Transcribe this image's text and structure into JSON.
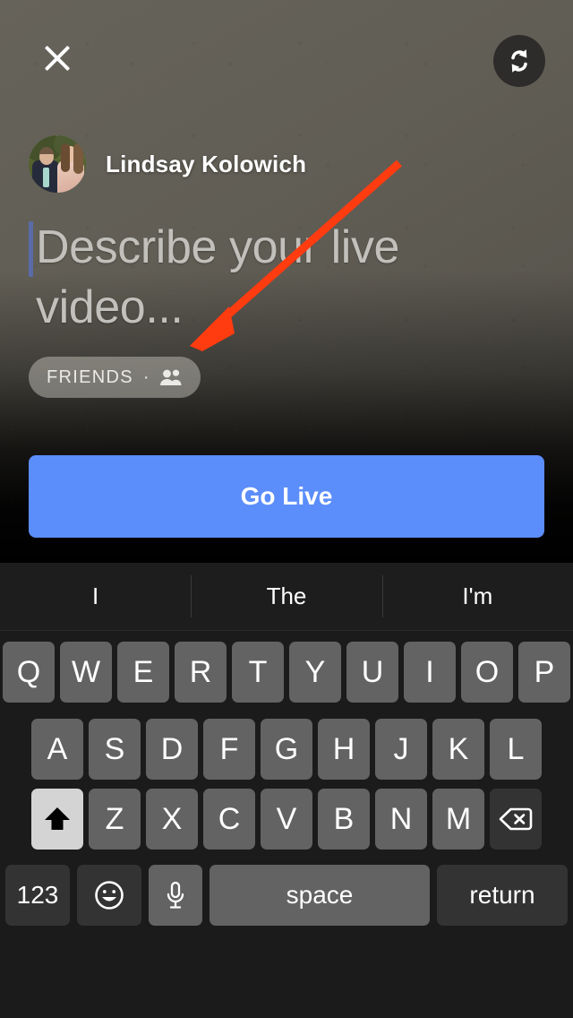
{
  "screen": {
    "app": "facebook-live-composer",
    "background_color": "#605D54",
    "accent_color": "#5B8DFB",
    "annotation_color": "#FF3B10"
  },
  "camera": {
    "close_icon": "close-icon",
    "flip_camera_icon": "camera-flip-icon"
  },
  "composer": {
    "author_name": "Lindsay Kolowich",
    "avatar_icon": "user-avatar-photo",
    "description_placeholder": "Describe your live video...",
    "privacy": {
      "label": "FRIENDS",
      "separator": "·",
      "audience_icon": "friends-people-icon"
    },
    "go_live_label": "Go Live"
  },
  "keyboard": {
    "predictions": [
      "I",
      "The",
      "I'm"
    ],
    "row1": [
      "Q",
      "W",
      "E",
      "R",
      "T",
      "Y",
      "U",
      "I",
      "O",
      "P"
    ],
    "row2": [
      "A",
      "S",
      "D",
      "F",
      "G",
      "H",
      "J",
      "K",
      "L"
    ],
    "row3": [
      "Z",
      "X",
      "C",
      "V",
      "B",
      "N",
      "M"
    ],
    "shift_icon": "shift-arrow-icon",
    "shift_active": "true",
    "delete_icon": "backspace-delete-icon",
    "numbers_label": "123",
    "emoji_icon": "emoji-smiley-icon",
    "mic_icon": "microphone-icon",
    "space_label": "space",
    "return_label": "return"
  }
}
